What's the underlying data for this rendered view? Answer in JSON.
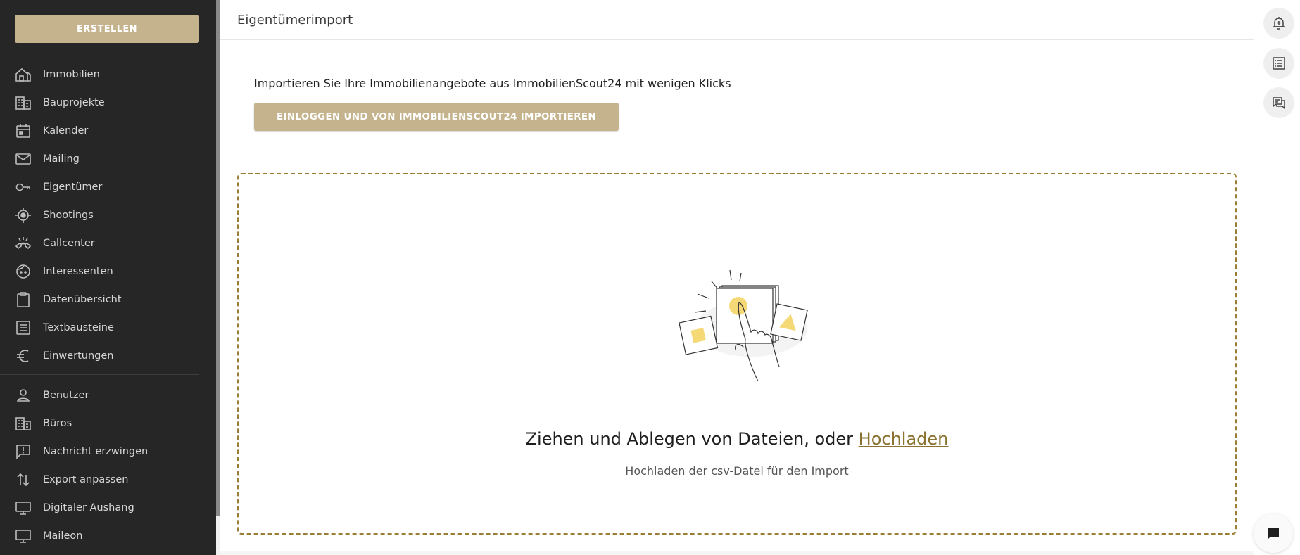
{
  "sidebar": {
    "create_label": "ERSTELLEN",
    "primary_items": [
      {
        "label": "Immobilien",
        "icon": "house-icon"
      },
      {
        "label": "Bauprojekte",
        "icon": "building-icon"
      },
      {
        "label": "Kalender",
        "icon": "calendar-icon"
      },
      {
        "label": "Mailing",
        "icon": "mail-icon"
      },
      {
        "label": "Eigentümer",
        "icon": "key-icon"
      },
      {
        "label": "Shootings",
        "icon": "target-icon"
      },
      {
        "label": "Callcenter",
        "icon": "phone-icon"
      },
      {
        "label": "Interessenten",
        "icon": "face-icon"
      },
      {
        "label": "Datenübersicht",
        "icon": "clipboard-icon"
      },
      {
        "label": "Textbausteine",
        "icon": "list-icon"
      },
      {
        "label": "Einwertungen",
        "icon": "euro-icon"
      }
    ],
    "secondary_items": [
      {
        "label": "Benutzer",
        "icon": "user-icon"
      },
      {
        "label": "Büros",
        "icon": "office-icon"
      },
      {
        "label": "Nachricht erzwingen",
        "icon": "message-alert-icon"
      },
      {
        "label": "Export anpassen",
        "icon": "sort-arrows-icon"
      },
      {
        "label": "Digitaler Aushang",
        "icon": "monitor-icon"
      },
      {
        "label": "Maileon",
        "icon": "monitor-icon"
      }
    ]
  },
  "header": {
    "title": "Eigentümerimport"
  },
  "import": {
    "intro": "Importieren Sie Ihre Immobilienangebote aus ImmobilienScout24 mit wenigen Klicks",
    "button_label": "EINLOGGEN UND VON IMMOBILIENSCOUT24 IMPORTIEREN"
  },
  "dropzone": {
    "text": "Ziehen und Ablegen von Dateien, oder",
    "link": "Hochladen",
    "subtext": "Hochladen der csv-Datei für den Import"
  },
  "rail": {
    "buttons": [
      "bell-plus-icon",
      "list-view-icon",
      "comments-icon"
    ],
    "chat": "chat-icon"
  },
  "colors": {
    "sidebar_bg": "#262626",
    "accent": "#c4b38c",
    "link": "#8a7230",
    "dropzone_border": "#9b7e35",
    "illustration_yellow": "#f6d977"
  }
}
